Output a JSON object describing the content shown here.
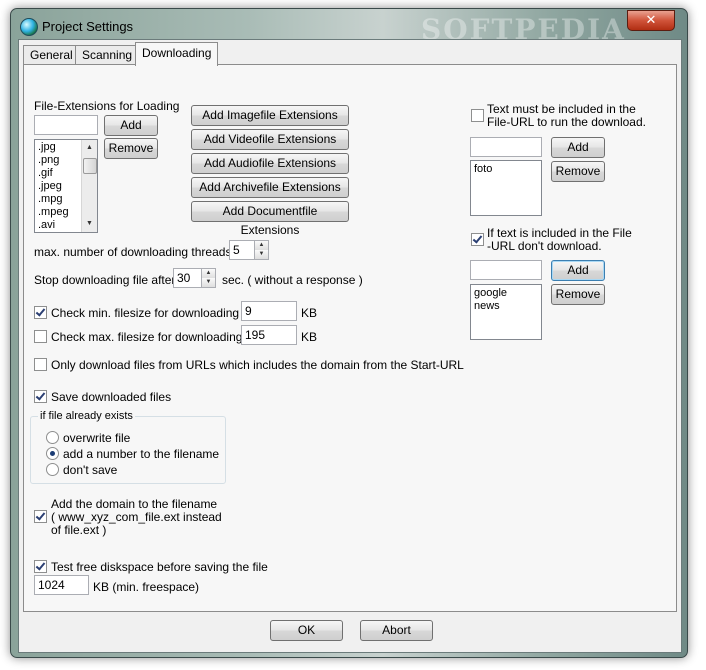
{
  "window": {
    "title": "Project Settings",
    "watermark": "SOFTPEDIA",
    "close_glyph": "✕"
  },
  "tabs": [
    {
      "label": "General",
      "active": false
    },
    {
      "label": "Scanning",
      "active": false
    },
    {
      "label": "Downloading",
      "active": true
    }
  ],
  "extensions": {
    "heading": "File-Extensions for Loading",
    "input_value": "",
    "add_label": "Add",
    "remove_label": "Remove",
    "list": [
      ".jpg",
      ".png",
      ".gif",
      ".jpeg",
      ".mpg",
      ".mpeg",
      ".avi"
    ],
    "preset_buttons": [
      "Add Imagefile Extensions",
      "Add Videofile Extensions",
      "Add Audiofile Extensions",
      "Add Archivefile Extensions",
      "Add Documentfile Extensions"
    ]
  },
  "threads": {
    "label": "max. number of downloading threads",
    "value": "5"
  },
  "timeout": {
    "label": "Stop downloading file after",
    "value": "30",
    "suffix": "sec. ( without a  response )"
  },
  "min_filesize": {
    "label": "Check min. filesize for downloading",
    "checked": true,
    "value": "9",
    "unit": "KB"
  },
  "max_filesize": {
    "label": "Check max. filesize for downloading",
    "checked": false,
    "value": "195",
    "unit": "KB"
  },
  "domain_only": {
    "label": "Only download files from URLs which includes the domain from the Start-URL",
    "checked": false
  },
  "save_files": {
    "label": "Save downloaded files",
    "checked": true
  },
  "if_exists": {
    "legend": "if file already exists",
    "options": [
      {
        "label": "overwrite file",
        "checked": false
      },
      {
        "label": "add a number to the filename",
        "checked": true
      },
      {
        "label": "don't save",
        "checked": false
      }
    ]
  },
  "add_domain": {
    "line1": "Add the domain to the filename",
    "line2": "( www_xyz_com_file.ext instead",
    "line3": "of file.ext )",
    "checked": true
  },
  "diskspace": {
    "label": "Test free diskspace before saving the file",
    "checked": true,
    "value": "1024",
    "suffix": "KB (min. freespace)"
  },
  "include_text": {
    "line1": "Text must be included in the",
    "line2": "File-URL to run the download.",
    "checked": false,
    "input_value": "",
    "add_label": "Add",
    "remove_label": "Remove",
    "list": [
      "foto"
    ]
  },
  "exclude_text": {
    "line1": "If text is included in the File",
    "line2": "-URL don't download.",
    "checked": true,
    "input_value": "",
    "add_label": "Add",
    "remove_label": "Remove",
    "list": [
      "google",
      "news"
    ]
  },
  "footer": {
    "ok_label": "OK",
    "abort_label": "Abort"
  }
}
